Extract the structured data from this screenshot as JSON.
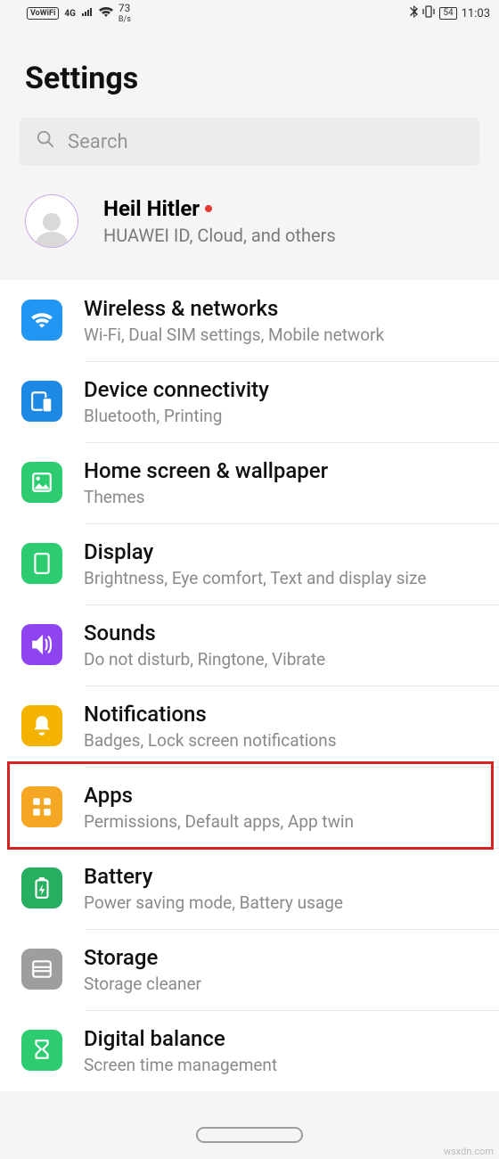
{
  "status": {
    "vowifi": "VoWiFi",
    "net_gen": "4G",
    "speed_num": "73",
    "speed_unit": "B/s",
    "battery": "54",
    "time": "11:03"
  },
  "title": "Settings",
  "search": {
    "placeholder": "Search"
  },
  "account": {
    "name": "Heil Hitler",
    "subtitle": "HUAWEI ID, Cloud, and others"
  },
  "items": [
    {
      "icon": "wifi-icon",
      "color": "blue",
      "label": "Wireless & networks",
      "sub": "Wi-Fi, Dual SIM settings, Mobile network"
    },
    {
      "icon": "device-icon",
      "color": "blue2",
      "label": "Device connectivity",
      "sub": "Bluetooth, Printing"
    },
    {
      "icon": "wallpaper-icon",
      "color": "green",
      "label": "Home screen & wallpaper",
      "sub": "Themes"
    },
    {
      "icon": "display-icon",
      "color": "green",
      "label": "Display",
      "sub": "Brightness, Eye comfort, Text and display size"
    },
    {
      "icon": "sound-icon",
      "color": "purple",
      "label": "Sounds",
      "sub": "Do not disturb, Ringtone, Vibrate"
    },
    {
      "icon": "bell-icon",
      "color": "amber",
      "label": "Notifications",
      "sub": "Badges, Lock screen notifications"
    },
    {
      "icon": "apps-icon",
      "color": "amber2",
      "label": "Apps",
      "sub": "Permissions, Default apps, App twin"
    },
    {
      "icon": "battery-icon",
      "color": "green2",
      "label": "Battery",
      "sub": "Power saving mode, Battery usage"
    },
    {
      "icon": "storage-icon",
      "color": "gray",
      "label": "Storage",
      "sub": "Storage cleaner"
    },
    {
      "icon": "hourglass-icon",
      "color": "green",
      "label": "Digital balance",
      "sub": "Screen time management"
    }
  ],
  "highlight_index": 6,
  "watermark": "wsxdn.com"
}
